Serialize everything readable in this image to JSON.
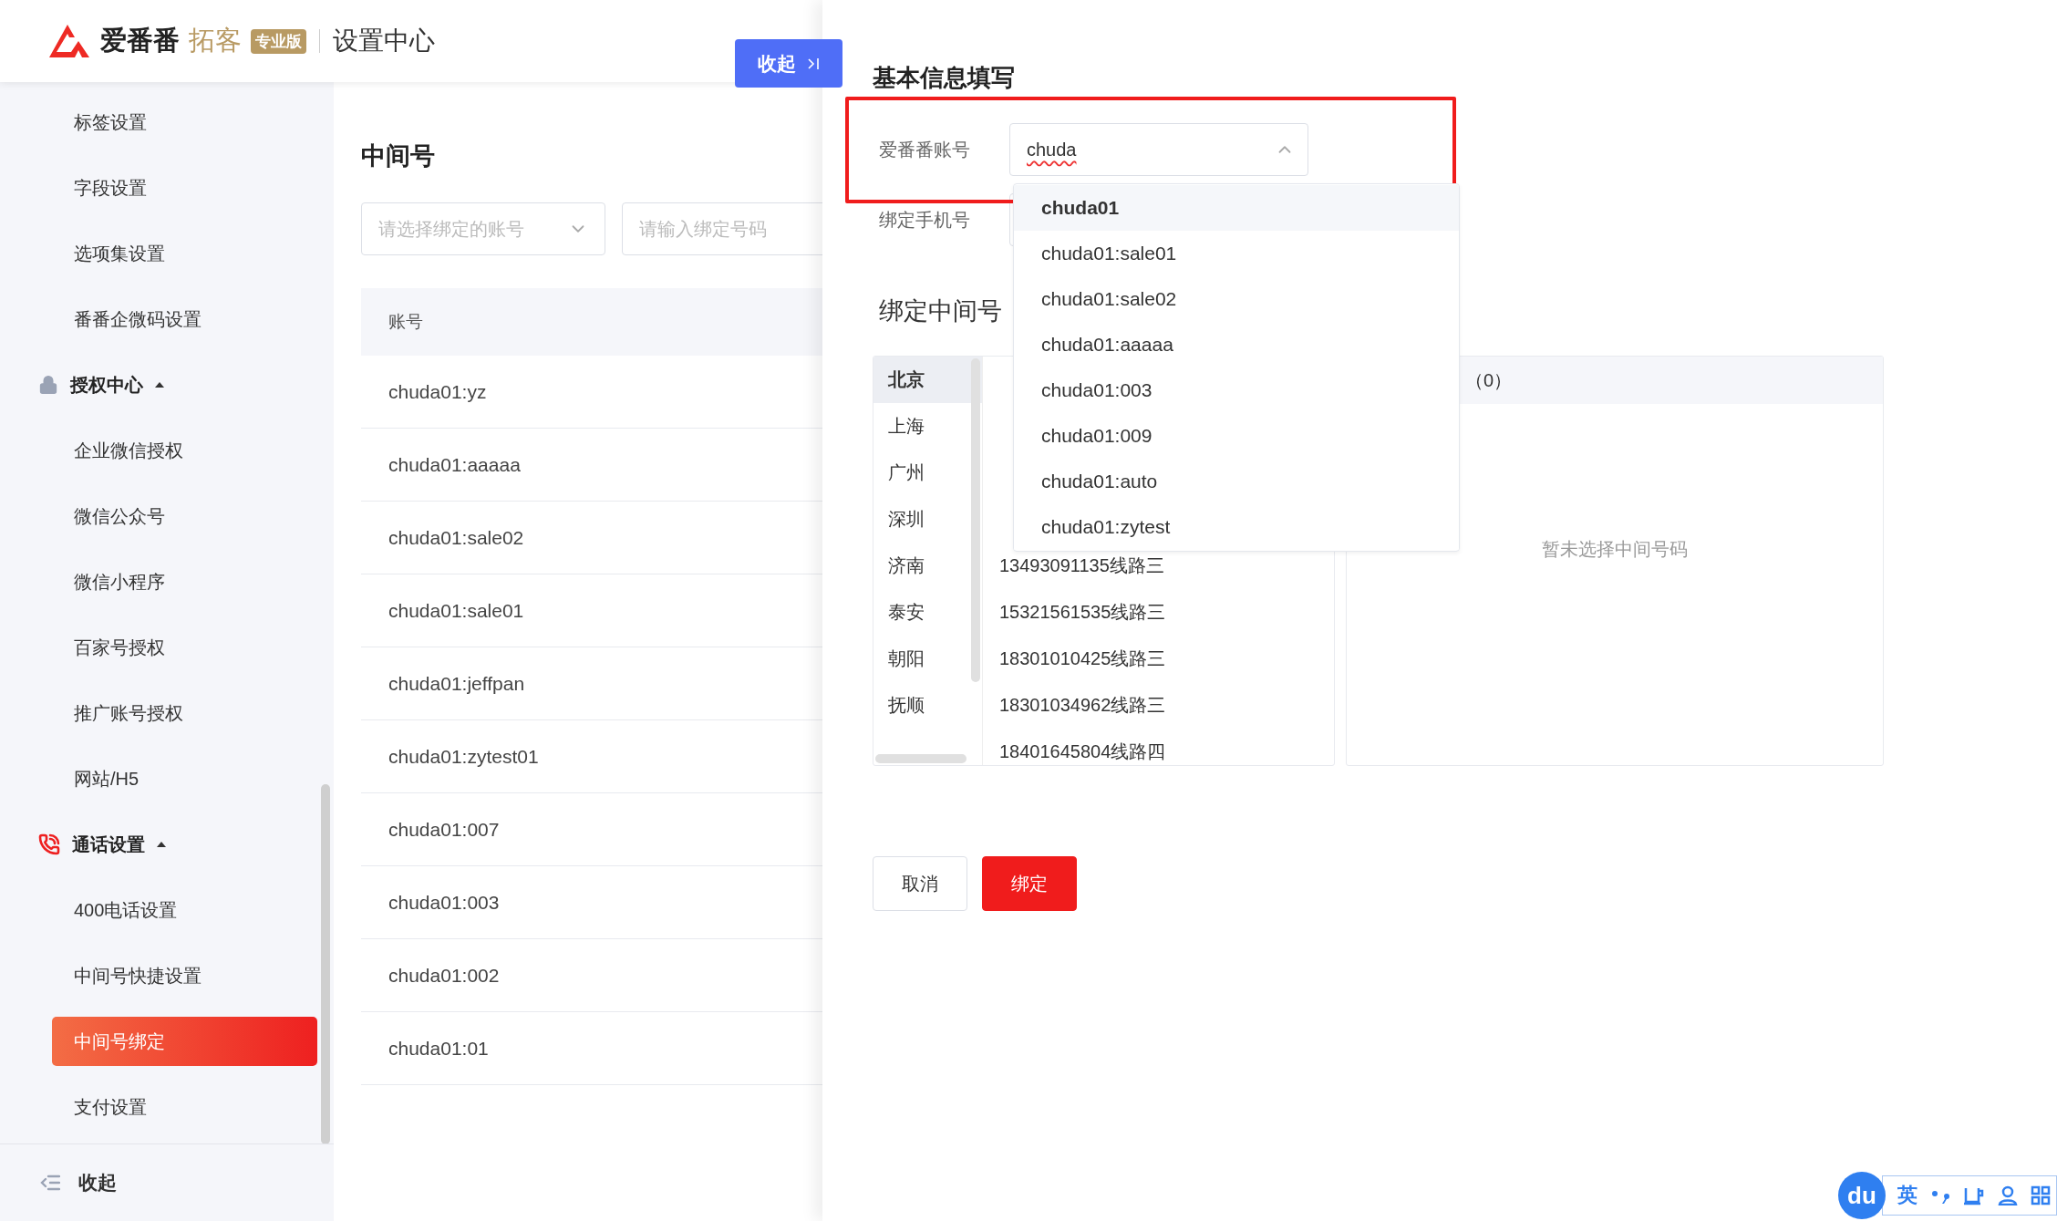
{
  "header": {
    "brand": "爱番番",
    "product": "拓客",
    "edition_badge": "专业版",
    "title": "设置中心"
  },
  "collapse_button": {
    "label": "收起"
  },
  "sidebar": {
    "items": [
      {
        "kind": "item",
        "label": "标签设置",
        "selected": false
      },
      {
        "kind": "item",
        "label": "字段设置",
        "selected": false
      },
      {
        "kind": "item",
        "label": "选项集设置",
        "selected": false
      },
      {
        "kind": "item",
        "label": "番番企微码设置",
        "selected": false
      },
      {
        "kind": "group",
        "label": "授权中心",
        "expanded": true,
        "children": [
          {
            "kind": "item",
            "label": "企业微信授权",
            "selected": false
          },
          {
            "kind": "item",
            "label": "微信公众号",
            "selected": false
          },
          {
            "kind": "item",
            "label": "微信小程序",
            "selected": false
          },
          {
            "kind": "item",
            "label": "百家号授权",
            "selected": false
          },
          {
            "kind": "item",
            "label": "推广账号授权",
            "selected": false
          },
          {
            "kind": "item",
            "label": "网站/H5",
            "selected": false
          }
        ]
      },
      {
        "kind": "group",
        "label": "通话设置",
        "expanded": true,
        "children": [
          {
            "kind": "item",
            "label": "400电话设置",
            "selected": false
          },
          {
            "kind": "item",
            "label": "中间号快捷设置",
            "selected": false
          },
          {
            "kind": "item",
            "label": "中间号绑定",
            "selected": true
          },
          {
            "kind": "item",
            "label": "支付设置",
            "selected": false
          }
        ]
      }
    ],
    "footer": {
      "label": "收起"
    }
  },
  "content": {
    "title": "中间号",
    "filters": [
      {
        "kind": "select",
        "placeholder": "请选择绑定的账号"
      },
      {
        "kind": "input",
        "placeholder": "请输入绑定号码"
      }
    ],
    "table": {
      "columns": [
        "账号"
      ],
      "rows": [
        [
          "chuda01:yz"
        ],
        [
          "chuda01:aaaaa"
        ],
        [
          "chuda01:sale02"
        ],
        [
          "chuda01:sale01"
        ],
        [
          "chuda01:jeffpan"
        ],
        [
          "chuda01:zytest01"
        ],
        [
          "chuda01:007"
        ],
        [
          "chuda01:003"
        ],
        [
          "chuda01:002"
        ],
        [
          "chuda01:01"
        ]
      ]
    }
  },
  "drawer": {
    "title": "基本信息填写",
    "fields": [
      {
        "label": "爱番番账号",
        "value": "chuda",
        "open": true,
        "annotated": true
      },
      {
        "label": "绑定手机号",
        "annotated": false
      }
    ],
    "dropdown": {
      "options": [
        {
          "label": "chuda01",
          "selected": true
        },
        {
          "label": "chuda01:sale01",
          "selected": false
        },
        {
          "label": "chuda01:sale02",
          "selected": false
        },
        {
          "label": "chuda01:aaaaa",
          "selected": false
        },
        {
          "label": "chuda01:003",
          "selected": false
        },
        {
          "label": "chuda01:009",
          "selected": false
        },
        {
          "label": "chuda01:auto",
          "selected": false
        },
        {
          "label": "chuda01:zytest",
          "selected": false
        }
      ]
    },
    "section_title": "绑定中间号",
    "transfer": {
      "cities": [
        {
          "label": "北京",
          "selected": true
        },
        {
          "label": "上海",
          "selected": false
        },
        {
          "label": "广州",
          "selected": false
        },
        {
          "label": "深圳",
          "selected": false
        },
        {
          "label": "济南",
          "selected": false
        },
        {
          "label": "泰安",
          "selected": false
        },
        {
          "label": "朝阳",
          "selected": false
        },
        {
          "label": "抚顺",
          "selected": false
        }
      ],
      "numbers": [
        "13493091135线路三",
        "15321561535线路三",
        "18301010425线路三",
        "18301034962线路三",
        "18401645804线路四"
      ],
      "selected_header": "（0）",
      "empty_text": "暂未选择中间号码"
    },
    "buttons": [
      {
        "kind": "default",
        "label": "取消"
      },
      {
        "kind": "primary",
        "label": "绑定"
      }
    ]
  },
  "ime": {
    "logo": "du",
    "mode": "英"
  }
}
